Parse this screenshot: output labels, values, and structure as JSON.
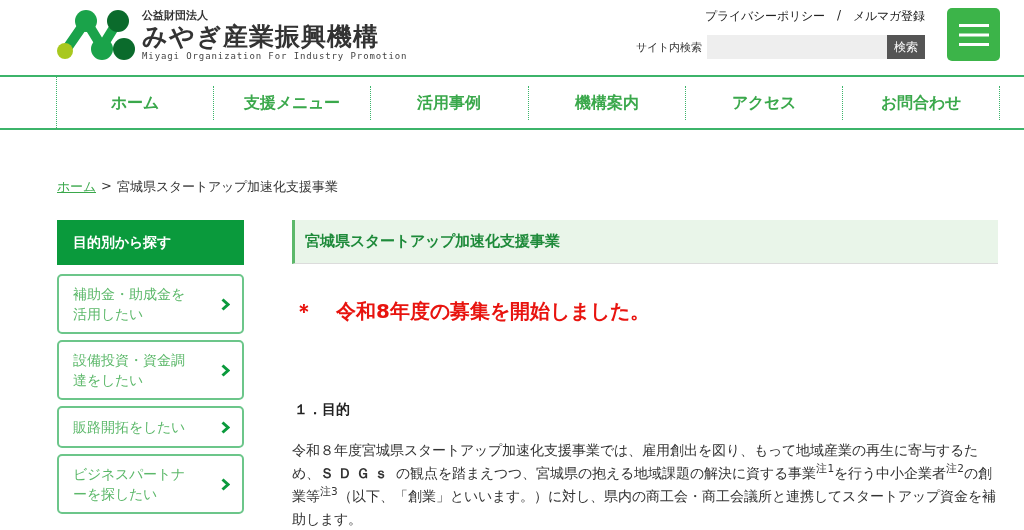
{
  "header": {
    "logo": {
      "org_type": "公益財団法人",
      "name": "みやぎ産業振興機構",
      "english": "Miyagi Organization For Industry Promotion"
    },
    "links": [
      "プライバシーポリシー",
      "/",
      "メルマガ登録"
    ],
    "search": {
      "label": "サイト内検索",
      "button": "検索"
    }
  },
  "nav": [
    {
      "label": "ホーム"
    },
    {
      "label": "支援メニュー"
    },
    {
      "label": "活用事例"
    },
    {
      "label": "機構案内"
    },
    {
      "label": "アクセス"
    },
    {
      "label": "お問合わせ"
    }
  ],
  "breadcrumb": {
    "home": "ホーム",
    "separator": ">",
    "current": "宮城県スタートアップ加速化支援事業"
  },
  "sidebar": {
    "heading": "目的別から探す",
    "items": [
      {
        "label": "補助金・助成金を活用したい"
      },
      {
        "label": "設備投資・資金調達をしたい"
      },
      {
        "label": "販路開拓をしたい"
      },
      {
        "label": "ビジネスパートナーを探したい"
      }
    ]
  },
  "main": {
    "title": "宮城県スタートアップ加速化支援事業",
    "notice_mark": "＊",
    "notice": "令和8年度の募集を開始しました。",
    "section_heading": "１．目的",
    "paragraph": "令和８年度宮城県スタートアップ加速化支援事業では、雇用創出を図り、もって地域産業の再生に寄与するため、**ＳＤＧｓ** の観点を踏まえつつ、宮城県の抱える地域課題の解決に資する事業$^{注1}$を行う中小企業者$^{注2}$の創業等$^{注3}$（以下、「創業」といいます。）に対し、県内の商工会・商工会議所と連携してスタートアップ資金を補助します。"
  }
}
